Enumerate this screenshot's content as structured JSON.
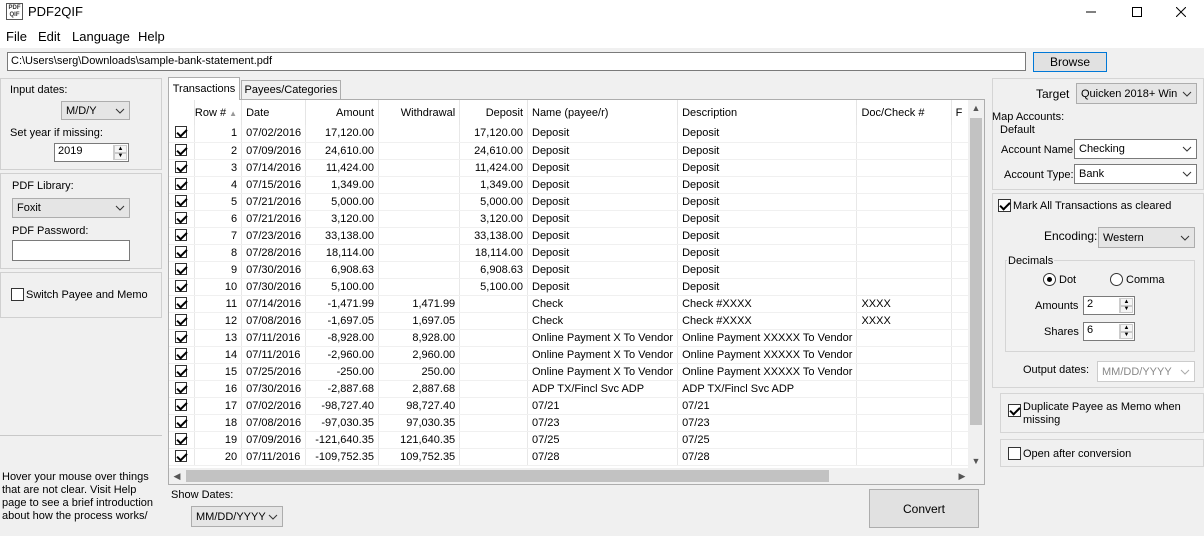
{
  "app": {
    "title": "PDF2QIF",
    "icon_text": "PDF QIF"
  },
  "window_controls": [
    "minimize-icon",
    "maximize-icon",
    "close-icon"
  ],
  "menu": [
    "File",
    "Edit",
    "Language",
    "Help"
  ],
  "file_path": "C:\\Users\\serg\\Downloads\\sample-bank-statement.pdf",
  "browse_label": "Browse",
  "left": {
    "input_dates_label": "Input dates:",
    "input_dates_value": "M/D/Y",
    "set_year_label": "Set year if missing:",
    "year_value": "2019",
    "pdf_library_label": "PDF Library:",
    "pdf_library_value": "Foxit",
    "pdf_password_label": "PDF Password:",
    "pdf_password_value": "",
    "switch_payee_label": "Switch Payee and Memo",
    "switch_payee_checked": false,
    "help_text": "Hover your mouse over things that are not clear. Visit Help page to see a brief introduction about how the process works/"
  },
  "tabs": [
    "Transactions",
    "Payees/Categories"
  ],
  "grid": {
    "columns": [
      "Row #",
      "Date",
      "Amount",
      "Withdrawal",
      "Deposit",
      "Name (payee/r)",
      "Description",
      "Doc/Check #",
      "F"
    ],
    "rows": [
      [
        "1",
        "07/02/2016",
        "17,120.00",
        "",
        "17,120.00",
        "Deposit",
        "Deposit",
        ""
      ],
      [
        "2",
        "07/09/2016",
        "24,610.00",
        "",
        "24,610.00",
        "Deposit",
        "Deposit",
        ""
      ],
      [
        "3",
        "07/14/2016",
        "11,424.00",
        "",
        "11,424.00",
        "Deposit",
        "Deposit",
        ""
      ],
      [
        "4",
        "07/15/2016",
        "1,349.00",
        "",
        "1,349.00",
        "Deposit",
        "Deposit",
        ""
      ],
      [
        "5",
        "07/21/2016",
        "5,000.00",
        "",
        "5,000.00",
        "Deposit",
        "Deposit",
        ""
      ],
      [
        "6",
        "07/21/2016",
        "3,120.00",
        "",
        "3,120.00",
        "Deposit",
        "Deposit",
        ""
      ],
      [
        "7",
        "07/23/2016",
        "33,138.00",
        "",
        "33,138.00",
        "Deposit",
        "Deposit",
        ""
      ],
      [
        "8",
        "07/28/2016",
        "18,114.00",
        "",
        "18,114.00",
        "Deposit",
        "Deposit",
        ""
      ],
      [
        "9",
        "07/30/2016",
        "6,908.63",
        "",
        "6,908.63",
        "Deposit",
        "Deposit",
        ""
      ],
      [
        "10",
        "07/30/2016",
        "5,100.00",
        "",
        "5,100.00",
        "Deposit",
        "Deposit",
        ""
      ],
      [
        "11",
        "07/14/2016",
        "-1,471.99",
        "1,471.99",
        "",
        "Check",
        "Check #XXXX",
        "XXXX"
      ],
      [
        "12",
        "07/08/2016",
        "-1,697.05",
        "1,697.05",
        "",
        "Check",
        "Check #XXXX",
        "XXXX"
      ],
      [
        "13",
        "07/11/2016",
        "-8,928.00",
        "8,928.00",
        "",
        "Online Payment X To Vendor",
        "Online Payment XXXXX To Vendor",
        ""
      ],
      [
        "14",
        "07/11/2016",
        "-2,960.00",
        "2,960.00",
        "",
        "Online Payment X To Vendor",
        "Online Payment XXXXX To Vendor",
        ""
      ],
      [
        "15",
        "07/25/2016",
        "-250.00",
        "250.00",
        "",
        "Online Payment X To Vendor",
        "Online Payment XXXXX To Vendor",
        ""
      ],
      [
        "16",
        "07/30/2016",
        "-2,887.68",
        "2,887.68",
        "",
        "ADP TX/Fincl Svc ADP",
        "ADP TX/Fincl Svc ADP",
        ""
      ],
      [
        "17",
        "07/02/2016",
        "-98,727.40",
        "98,727.40",
        "",
        "07/21",
        "07/21",
        ""
      ],
      [
        "18",
        "07/08/2016",
        "-97,030.35",
        "97,030.35",
        "",
        "07/23",
        "07/23",
        ""
      ],
      [
        "19",
        "07/09/2016",
        "-121,640.35",
        "121,640.35",
        "",
        "07/25",
        "07/25",
        ""
      ],
      [
        "20",
        "07/11/2016",
        "-109,752.35",
        "109,752.35",
        "",
        "07/28",
        "07/28",
        ""
      ]
    ]
  },
  "show_dates_label": "Show Dates:",
  "show_dates_value": "MM/DD/YYYY",
  "convert_label": "Convert",
  "right": {
    "target_label": "Target",
    "target_value": "Quicken 2018+ Win",
    "map_accounts_label": "Map Accounts:",
    "default_label": "Default",
    "account_name_label": "Account Name:",
    "account_name_value": "Checking",
    "account_type_label": "Account Type:",
    "account_type_value": "Bank",
    "mark_cleared_label": "Mark All Transactions as cleared",
    "encoding_label": "Encoding:",
    "encoding_value": "Western",
    "decimals_label": "Decimals",
    "dot_label": "Dot",
    "comma_label": "Comma",
    "amounts_label": "Amounts",
    "amounts_value": "2",
    "shares_label": "Shares",
    "shares_value": "6",
    "output_dates_label": "Output dates:",
    "output_dates_value": "MM/DD/YYYY",
    "duplicate_payee_label": "Duplicate Payee as Memo when missing",
    "open_after_label": "Open after conversion"
  }
}
